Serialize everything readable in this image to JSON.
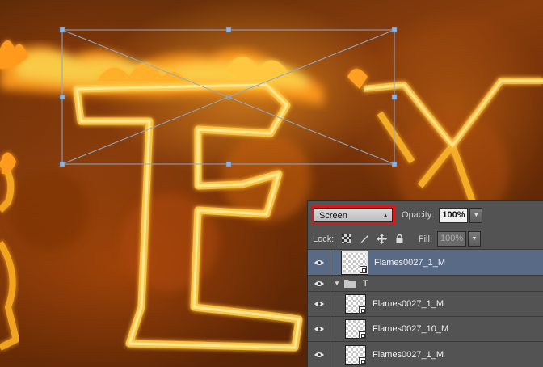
{
  "layers_panel": {
    "blend_mode": "Screen",
    "opacity_label": "Opacity:",
    "opacity_value": "100%",
    "lock_label": "Lock:",
    "fill_label": "Fill:",
    "fill_value": "100%",
    "layers": [
      {
        "name": "Flames0027_1_M",
        "type": "smart-object",
        "selected": true,
        "visible": true
      },
      {
        "name": "T",
        "type": "group",
        "expanded": true,
        "visible": true
      },
      {
        "name": "Flames0027_1_M",
        "type": "smart-object",
        "selected": false,
        "visible": true
      },
      {
        "name": "Flames0027_10_M",
        "type": "smart-object",
        "selected": false,
        "visible": true
      },
      {
        "name": "Flames0027_1_M",
        "type": "smart-object",
        "selected": false,
        "visible": true
      }
    ]
  },
  "colors": {
    "highlight_border": "#d41a1a",
    "selected_layer": "#596a87",
    "panel_bg": "#535353",
    "transform_box": "#8fa8c8"
  },
  "icons": [
    "eye-icon",
    "folder-icon",
    "lock-transparent-icon",
    "lock-paint-icon",
    "lock-move-icon",
    "lock-all-icon",
    "chevron-down-icon",
    "smart-object-icon"
  ]
}
